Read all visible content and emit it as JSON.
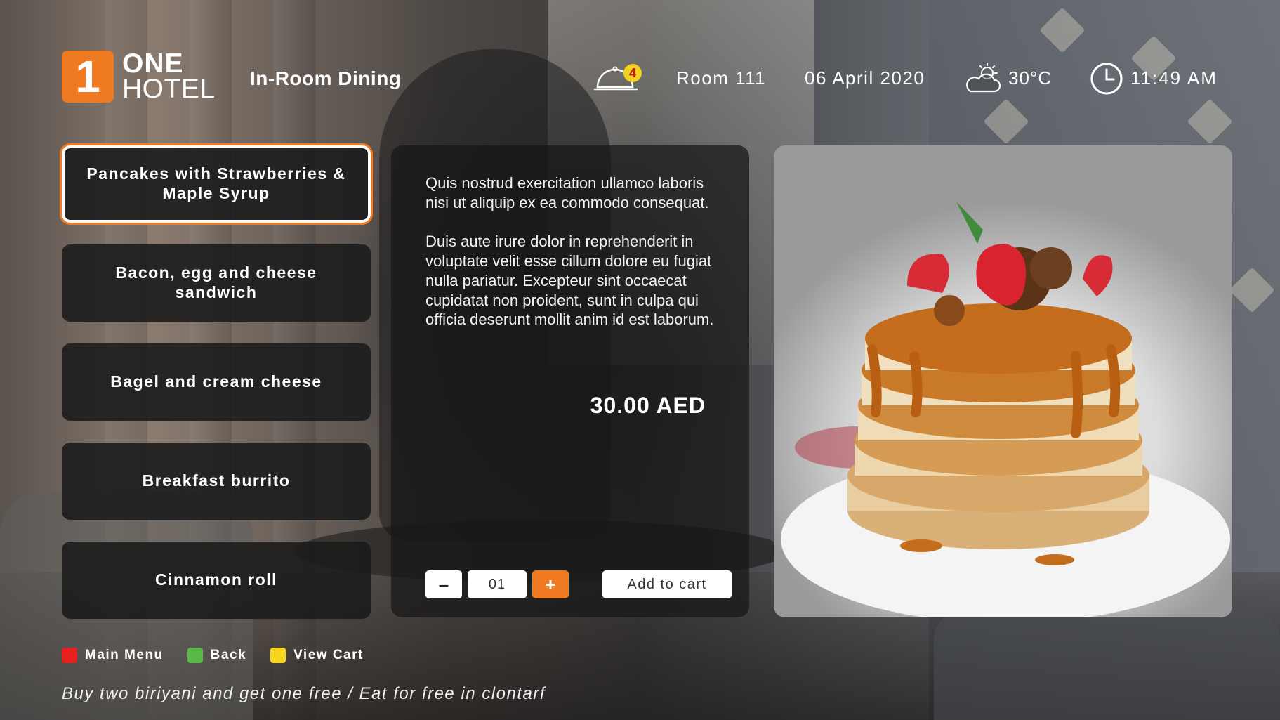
{
  "brand": {
    "logo_number": "1",
    "name_line1": "ONE",
    "name_line2": "HOTEL"
  },
  "header": {
    "title": "In-Room Dining",
    "notification_count": "4",
    "room": "Room 111",
    "date": "06 April 2020",
    "temperature": "30°C",
    "time": "11:49 AM",
    "icons": {
      "notifications": "room-service-bell-icon",
      "weather": "partly-cloudy-icon",
      "clock": "clock-icon"
    }
  },
  "menu": {
    "items": [
      {
        "label": "Pancakes with Strawberries & Maple Syrup",
        "selected": true
      },
      {
        "label": "Bacon, egg and cheese sandwich",
        "selected": false
      },
      {
        "label": "Bagel and cream cheese",
        "selected": false
      },
      {
        "label": "Breakfast burrito",
        "selected": false
      },
      {
        "label": "Cinnamon roll",
        "selected": false
      }
    ]
  },
  "detail": {
    "description": [
      "Quis nostrud exercitation ullamco laboris nisi ut aliquip ex ea commodo consequat.",
      "Duis aute irure dolor in reprehenderit in voluptate velit esse cillum dolore eu fugiat nulla pariatur. Excepteur sint occaecat cupidatat non proident, sunt in culpa qui officia deserunt mollit anim id est laborum."
    ],
    "price": "30.00 AED",
    "quantity": "01",
    "decrement_label": "–",
    "increment_label": "+",
    "add_to_cart_label": "Add to cart"
  },
  "legend": {
    "items": [
      {
        "label": "Main Menu",
        "color": "#e5201f"
      },
      {
        "label": "Back",
        "color": "#58b947"
      },
      {
        "label": "View Cart",
        "color": "#f7d51d"
      }
    ]
  },
  "ticker": "Buy two biriyani and get one free /  Eat for free in clontarf",
  "colors": {
    "accent": "#f07a22",
    "panel": "#1c1c1c",
    "text": "#ffffff"
  }
}
